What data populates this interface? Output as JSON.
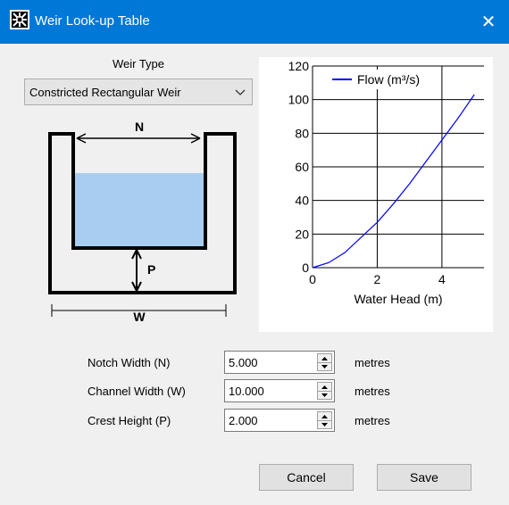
{
  "window": {
    "title": "Weir Look-up Table",
    "close_glyph": "✕"
  },
  "weir_type": {
    "label": "Weir Type",
    "selected": "Constricted Rectangular Weir"
  },
  "diagram": {
    "n_label": "N",
    "p_label": "P",
    "w_label": "W",
    "water_color": "#a9cdf0"
  },
  "chart_data": {
    "type": "line",
    "series": [
      {
        "name": "Flow (m³/s)",
        "color": "#0000ff",
        "x": [
          0,
          0.5,
          1,
          1.5,
          2,
          2.5,
          3,
          3.5,
          4,
          4.5,
          5
        ],
        "y": [
          0,
          3,
          9,
          18,
          27,
          38,
          50,
          63,
          76,
          89,
          103
        ]
      }
    ],
    "xlabel": "Water Head (m)",
    "xlim": [
      0,
      5.3
    ],
    "ylim": [
      0,
      120
    ],
    "xticks": [
      0,
      2,
      4
    ],
    "yticks": [
      0,
      20,
      40,
      60,
      80,
      100,
      120
    ],
    "grid": true,
    "legend": "top"
  },
  "fields": [
    {
      "label": "Notch Width (N)",
      "value": "5.000",
      "unit": "metres"
    },
    {
      "label": "Channel Width (W)",
      "value": "10.000",
      "unit": "metres"
    },
    {
      "label": "Crest Height (P)",
      "value": "2.000",
      "unit": "metres"
    }
  ],
  "buttons": {
    "cancel": "Cancel",
    "save": "Save"
  }
}
